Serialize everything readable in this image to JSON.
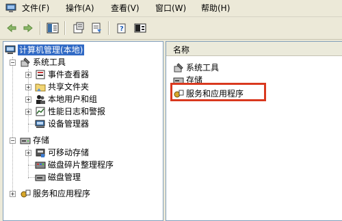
{
  "menu": {
    "items": [
      "文件(F)",
      "操作(A)",
      "查看(V)",
      "窗口(W)",
      "帮助(H)"
    ]
  },
  "toolbar": {
    "icons": [
      "back-arrow-icon",
      "forward-arrow-icon",
      "show-hide-tree-icon",
      "properties-icon",
      "export-list-icon",
      "help-icon",
      "view-icon"
    ]
  },
  "tree": {
    "root": "计算机管理(本地)",
    "system_tools": "系统工具",
    "event_viewer": "事件查看器",
    "shared_folders": "共享文件夹",
    "local_users": "本地用户和组",
    "perf_logs": "性能日志和警报",
    "device_manager": "设备管理器",
    "storage": "存储",
    "removable_storage": "可移动存储",
    "defrag": "磁盘碎片整理程序",
    "disk_mgmt": "磁盘管理",
    "services_apps": "服务和应用程序"
  },
  "list": {
    "header": "名称",
    "items": [
      "系统工具",
      "存储",
      "服务和应用程序"
    ]
  },
  "colors": {
    "selection": "#316ac5",
    "highlight": "#d9381e"
  }
}
